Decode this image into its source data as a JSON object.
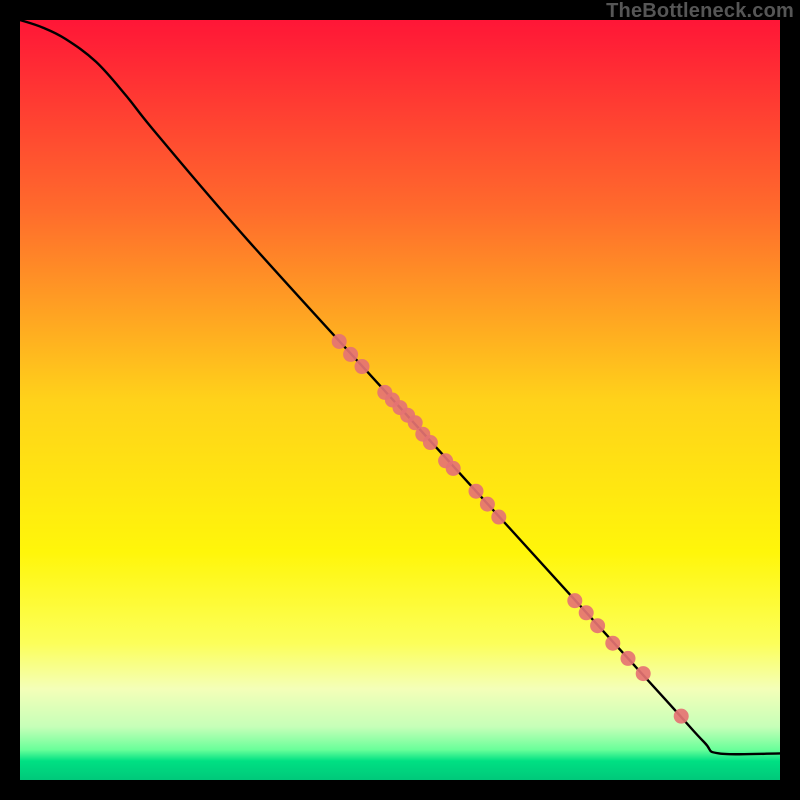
{
  "attribution": "TheBottleneck.com",
  "chart_data": {
    "type": "line",
    "title": "",
    "xlabel": "",
    "ylabel": "",
    "xlim": [
      0,
      100
    ],
    "ylim": [
      0,
      100
    ],
    "gradient_stops": [
      {
        "offset": 0.0,
        "color": "#ff1637"
      },
      {
        "offset": 0.25,
        "color": "#ff6b2c"
      },
      {
        "offset": 0.5,
        "color": "#ffd21a"
      },
      {
        "offset": 0.7,
        "color": "#fff60a"
      },
      {
        "offset": 0.82,
        "color": "#fcff5a"
      },
      {
        "offset": 0.88,
        "color": "#f4ffb8"
      },
      {
        "offset": 0.93,
        "color": "#c6ffb8"
      },
      {
        "offset": 0.96,
        "color": "#6aff9a"
      },
      {
        "offset": 0.975,
        "color": "#00e083"
      },
      {
        "offset": 1.0,
        "color": "#00c87a"
      }
    ],
    "series": [
      {
        "name": "curve",
        "x": [
          0,
          3,
          6,
          10,
          14,
          18,
          30,
          50,
          70,
          85,
          90,
          92,
          100
        ],
        "y": [
          100,
          99,
          97.5,
          94.5,
          90,
          85,
          71,
          49,
          27,
          10.5,
          5,
          3.5,
          3.5
        ]
      }
    ],
    "markers": {
      "name": "points",
      "color": "#e57373",
      "x": [
        42,
        43.5,
        45,
        48,
        49,
        50,
        51,
        52,
        53,
        54,
        56,
        57,
        60,
        61.5,
        63,
        73,
        74.5,
        76,
        78,
        80,
        82,
        87
      ],
      "y": [
        57.7,
        56,
        54.4,
        51,
        50,
        49,
        48,
        47,
        45.5,
        44.4,
        42,
        41,
        38,
        36.3,
        34.6,
        23.6,
        22,
        20.3,
        18,
        16,
        14,
        8.4
      ]
    }
  }
}
